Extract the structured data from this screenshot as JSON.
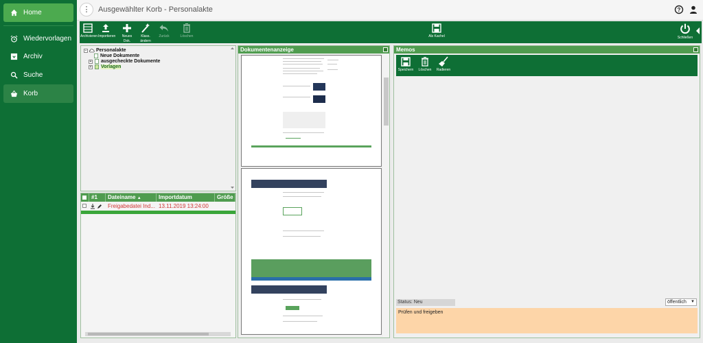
{
  "nav": {
    "items": [
      {
        "label": "Home",
        "icon": "home-icon"
      },
      {
        "label": "Wiedervorlagen",
        "icon": "alarm-clock-icon"
      },
      {
        "label": "Archiv",
        "icon": "archive-box-icon"
      },
      {
        "label": "Suche",
        "icon": "search-icon"
      },
      {
        "label": "Korb",
        "icon": "basket-icon"
      }
    ]
  },
  "header": {
    "menu_glyph": "⋮",
    "title": "Ausgewählter Korb - Personalakte"
  },
  "toolbar": {
    "archive": "Archivieren",
    "import": "Importieren",
    "new_doc": "Neues Dok.",
    "class": "Klass. ändern",
    "back": "Zurück",
    "delete": "Löschen",
    "as_tile": "Als Kachel",
    "close": "Schließen"
  },
  "tree": {
    "root": "Personalakte",
    "children": [
      "Neue Dokumente",
      "ausgecheckte Dokumente",
      "Vorlagen"
    ]
  },
  "doclist": {
    "columns": [
      "#1",
      "Dateiname",
      "Importdatum",
      "Größe"
    ],
    "rows": [
      {
        "filename": "Freigabedatei Ind...",
        "date": "13.11.2019 13:24:00"
      }
    ]
  },
  "viewer": {
    "title": "Dokumentenanzeige"
  },
  "memos": {
    "title": "Memos",
    "save": "Speichern",
    "delete": "Löschen",
    "eraser": "Radieren",
    "status": "Status: Neu",
    "visibility": "öffentlich",
    "text": "Prüfen und freigeben"
  },
  "colors": {
    "brand": "#0e6f35",
    "active": "#4caa4f",
    "header": "#4f9c4f",
    "memo_bg": "#fdd5a8",
    "row_text": "#d23535"
  }
}
